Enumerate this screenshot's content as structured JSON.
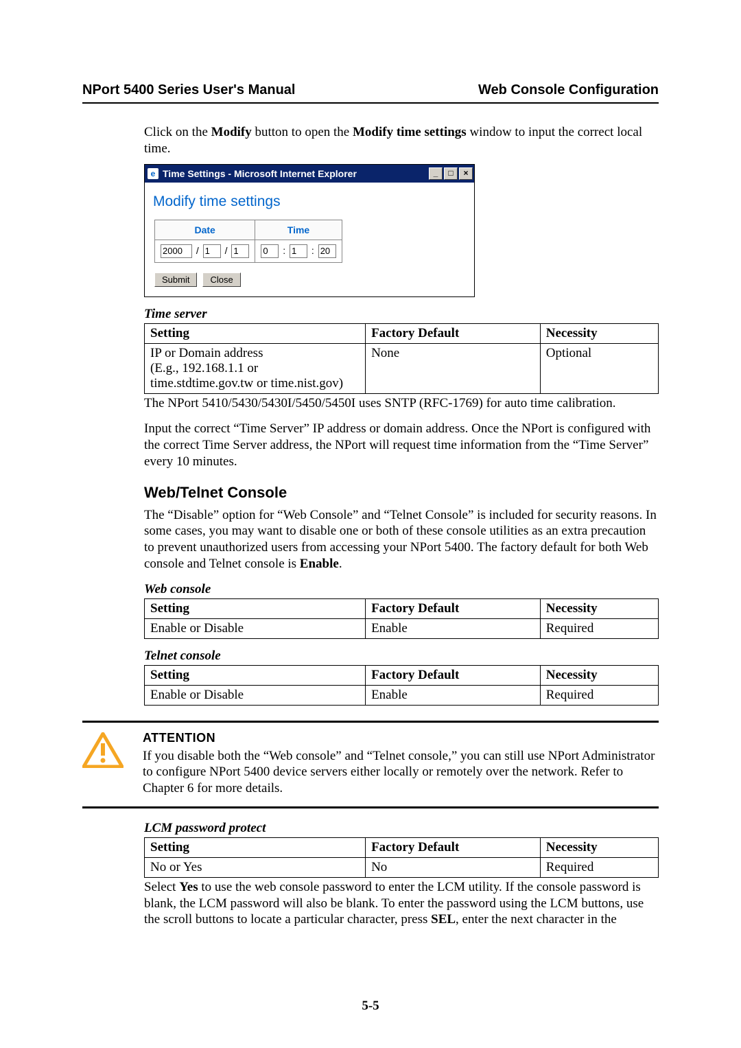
{
  "header": {
    "left": "NPort 5400 Series User's Manual",
    "right": "Web Console Configuration"
  },
  "intro_html": "Click on the <b>Modify</b> button to open the <b>Modify time settings</b> window to input the correct local time.",
  "dialog": {
    "window_title": "Time Settings - Microsoft Internet Explorer",
    "title": "Modify time settings",
    "date_label": "Date",
    "time_label": "Time",
    "year": "2000",
    "month": "1",
    "day": "1",
    "hour": "0",
    "minute": "1",
    "second": "20",
    "submit": "Submit",
    "close": "Close"
  },
  "table_headers": {
    "setting": "Setting",
    "factory_default": "Factory Default",
    "necessity": "Necessity"
  },
  "time_server": {
    "caption": "Time server",
    "setting_line1": "IP or Domain address",
    "setting_line2": "(E.g., 192.168.1.1 or time.stdtime.gov.tw or time.nist.gov)",
    "default": "None",
    "necessity": "Optional",
    "note": "The NPort 5410/5430/5430I/5450/5450I uses SNTP (RFC-1769) for auto time calibration."
  },
  "time_server_para": "Input the correct “Time Server” IP address or domain address. Once the NPort is configured with the correct Time Server address, the NPort will request time information from the “Time Server” every 10 minutes.",
  "web_telnet": {
    "heading": "Web/Telnet Console",
    "para_html": "The “Disable” option for “Web Console” and “Telnet Console” is included for security reasons. In some cases, you may want to disable one or both of these console utilities as an extra precaution to prevent unauthorized users from accessing your NPort 5400. The factory default for both Web console and Telnet console is <b>Enable</b>."
  },
  "web_console": {
    "caption": "Web console",
    "setting": "Enable or Disable",
    "default": "Enable",
    "necessity": "Required"
  },
  "telnet_console": {
    "caption": "Telnet console",
    "setting": "Enable or Disable",
    "default": "Enable",
    "necessity": "Required"
  },
  "attention": {
    "title": "ATTENTION",
    "body": "If you disable both the “Web console” and “Telnet console,” you can still use NPort Administrator to configure NPort 5400 device servers either locally or remotely over the network. Refer to Chapter 6 for more details."
  },
  "lcm": {
    "caption": "LCM password protect",
    "setting": "No or Yes",
    "default": "No",
    "necessity": "Required",
    "note_html": "Select <b>Yes</b> to use the web console password to enter the LCM utility. If the console password is blank, the LCM password will also be blank. To enter the password using the LCM buttons, use the scroll buttons to locate a particular character, press <b>SEL</b>, enter the next character in the"
  },
  "page_number": "5-5"
}
